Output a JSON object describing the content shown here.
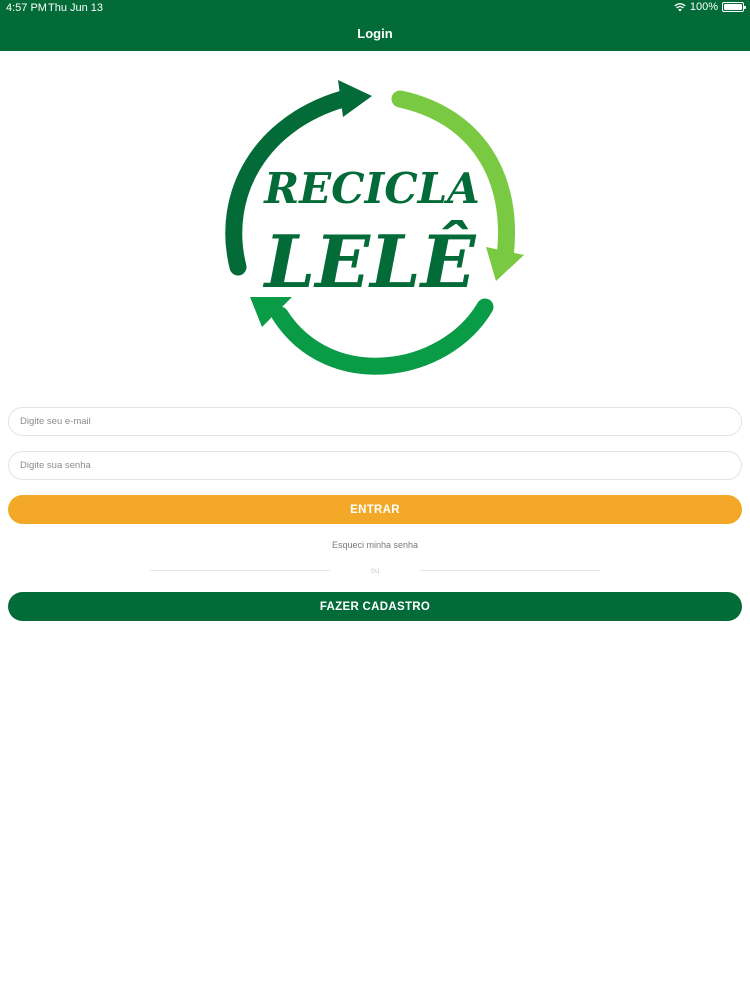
{
  "status_bar": {
    "time": "4:57 PM",
    "date": "Thu Jun 13",
    "battery": "100%"
  },
  "nav": {
    "title": "Login"
  },
  "logo": {
    "line1": "RECICLA",
    "line2": "LELÊ"
  },
  "form": {
    "email_placeholder": "Digite seu e-mail",
    "password_placeholder": "Digite sua senha",
    "enter_label": "ENTRAR",
    "forgot_label": "Esqueci minha senha",
    "or_label": "ou",
    "signup_label": "FAZER CADASTRO"
  },
  "colors": {
    "brand_green": "#036b37",
    "mid_green": "#0a9b47",
    "light_green": "#7ac943",
    "accent_orange": "#f3a827"
  }
}
